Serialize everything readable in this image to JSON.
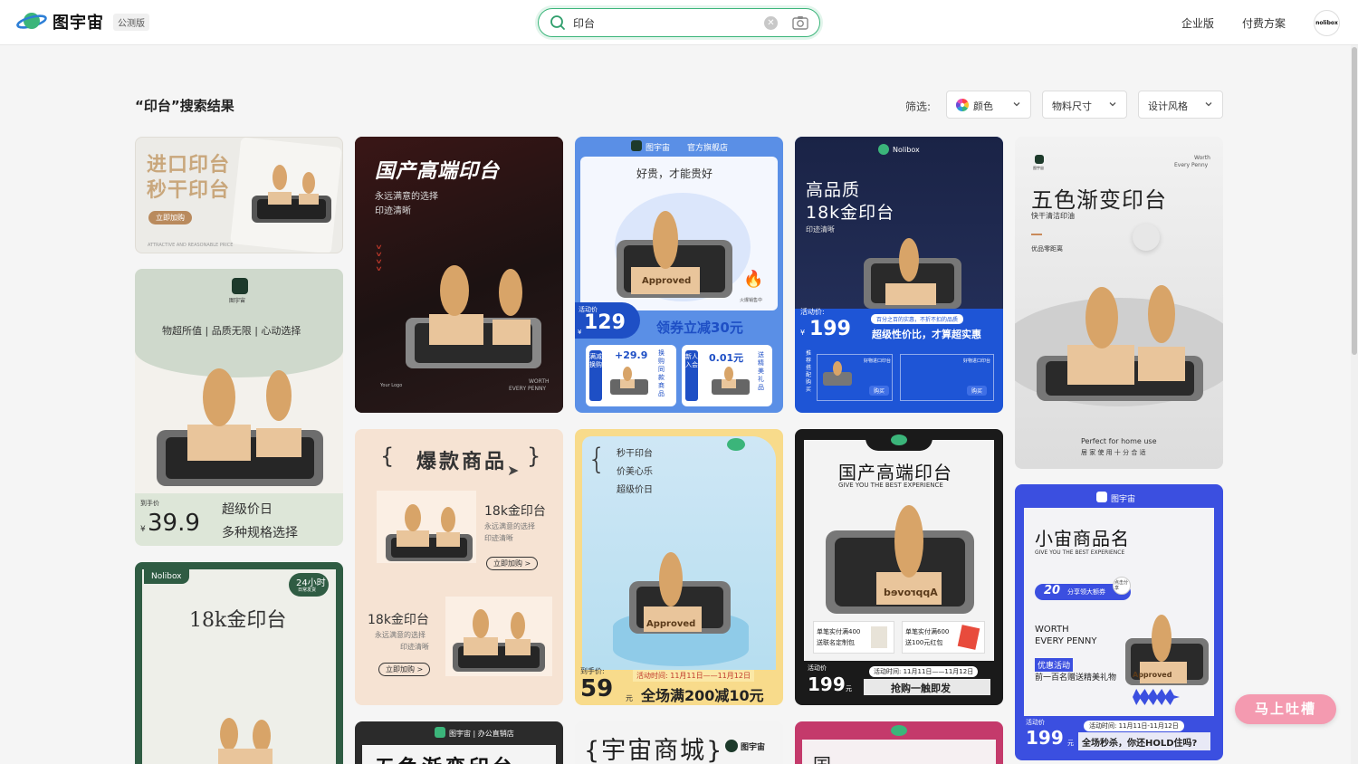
{
  "header": {
    "logo_text": "图宇宙",
    "logo_badge": "公测版",
    "search_value": "印台",
    "nav": [
      "企业版",
      "付费方案"
    ],
    "avatar_text": "nolibox"
  },
  "results": {
    "title": "“印台”搜索结果",
    "filter_label": "筛选:",
    "filters": [
      "颜色",
      "物料尺寸",
      "设计风格"
    ]
  },
  "cards": {
    "c1": {
      "line1": "进口印台",
      "line2": "秒干印台",
      "btn": "立即加购",
      "foot": "ATTRACTIVE AND REASONABLE PRICE"
    },
    "c2": {
      "logo": "图宇宙",
      "tagline": "物超所值 | 品质无限 | 心动选择",
      "price_label": "到手价",
      "currency": "¥",
      "price": "39.9",
      "sub1": "超级价日",
      "sub2": "多种规格选择"
    },
    "c3": {
      "brand": "Nolibox",
      "badge": "24小时",
      "badge_sub": "日常发货",
      "title": "18k金印台"
    },
    "c4": {
      "title": "国产高端印台",
      "sub1": "永远满意的选择",
      "sub2": "印迹清晰",
      "foot_left": "Your Logo",
      "foot_right1": "WORTH",
      "foot_right2": "EVERY PENNY"
    },
    "c5": {
      "brace_open": "{",
      "title": "爆款商品",
      "brace_close": "}",
      "r1_title": "18k金印台",
      "r1_sub1": "永远满意的选择",
      "r1_sub2": "印迹清晰",
      "r1_btn": "立即加购 >",
      "r2_title": "18k金印台",
      "r2_sub1": "永远满意的选择",
      "r2_sub2": "印迹清晰",
      "r2_btn": "立即加购 >"
    },
    "c6": {
      "store": "图宇宙 | 办公直销店",
      "title": "五色渐变印台"
    },
    "c7": {
      "store_logo": "图宇宙",
      "store_name": "官方旗舰店",
      "tagline": "好贵，才能贵好",
      "stamp_text": "Approved",
      "flame_note": "火爆销售中",
      "price_label": "活动价",
      "currency": "¥",
      "price": "129",
      "coupon": "领券立减30元",
      "b1_side": "满减换购",
      "b1_price": "+29.9",
      "b1_vert": "换购同款商品",
      "b2_side": "新人入会",
      "b2_price": "0.01元",
      "b2_vert": "送精美礼品"
    },
    "c8": {
      "l1": "秒干印台",
      "l2": "价美心乐",
      "l3": "超级价日",
      "stamp_text": "Approved",
      "price_label": "到手价:",
      "price": "59",
      "unit": "元",
      "period": "活动时间: 11月11日——11月12日",
      "promo": "全场满200减10元"
    },
    "c9": {
      "title_left": "{宇宙商城}",
      "logo": "图宇宙"
    },
    "c10": {
      "brand": "Nolibox",
      "t1": "高品质",
      "t2": "18k金印台",
      "sub": "印迹清晰",
      "price_label": "活动价:",
      "currency": "¥",
      "price": "199",
      "banner": "百分之百的实惠，不折不扣的品质",
      "slogan": "超级性价比，才算超实惠",
      "side": "推荐搭配购买",
      "i1": "好物进口印台",
      "i2": "好物进口印台",
      "btn": "购买"
    },
    "c11": {
      "title": "国产高端印台",
      "sub": "GIVE YOU THE BEST EXPERIENCE",
      "stamp_text": "Approved",
      "coupon1a": "单笔实付满400",
      "coupon1b": "送联名定制包",
      "coupon2a": "单笔实付满600",
      "coupon2b": "送100元红包",
      "price_label": "活动价",
      "price": "199",
      "unit": "元",
      "period": "活动时间: 11月11日——11月12日",
      "cta": "抢购一触即发"
    },
    "c12": {
      "title": "国"
    },
    "c13": {
      "logo_text": "图宇宙",
      "top_right1": "Worth",
      "top_right2": "Every Penny",
      "title": "五色渐变印台",
      "sub": "快干清洁印油",
      "feat": "优品零距离",
      "foot1": "Perfect for home use",
      "foot2": "居 家 使 用 十 分 合 适"
    },
    "c14": {
      "logo": "图宇宙",
      "title": "小宙商品名",
      "sub": "GIVE YOU THE BEST EXPERIENCE",
      "coupon_amount": "20",
      "coupon_text": "分享领大额券",
      "share": "点击分享",
      "worth1": "WORTH",
      "worth2": "EVERY PENNY",
      "promo_tag": "优惠活动",
      "promo": "前一百名赠送精美礼物",
      "stamp_text": "Approved",
      "price_label": "活动价",
      "price": "199",
      "unit": "元",
      "period": "活动时间: 11月11日-11月12日",
      "slogan": "全场秒杀，你还HOLD住吗?"
    }
  },
  "feedback_label": "马上吐槽"
}
